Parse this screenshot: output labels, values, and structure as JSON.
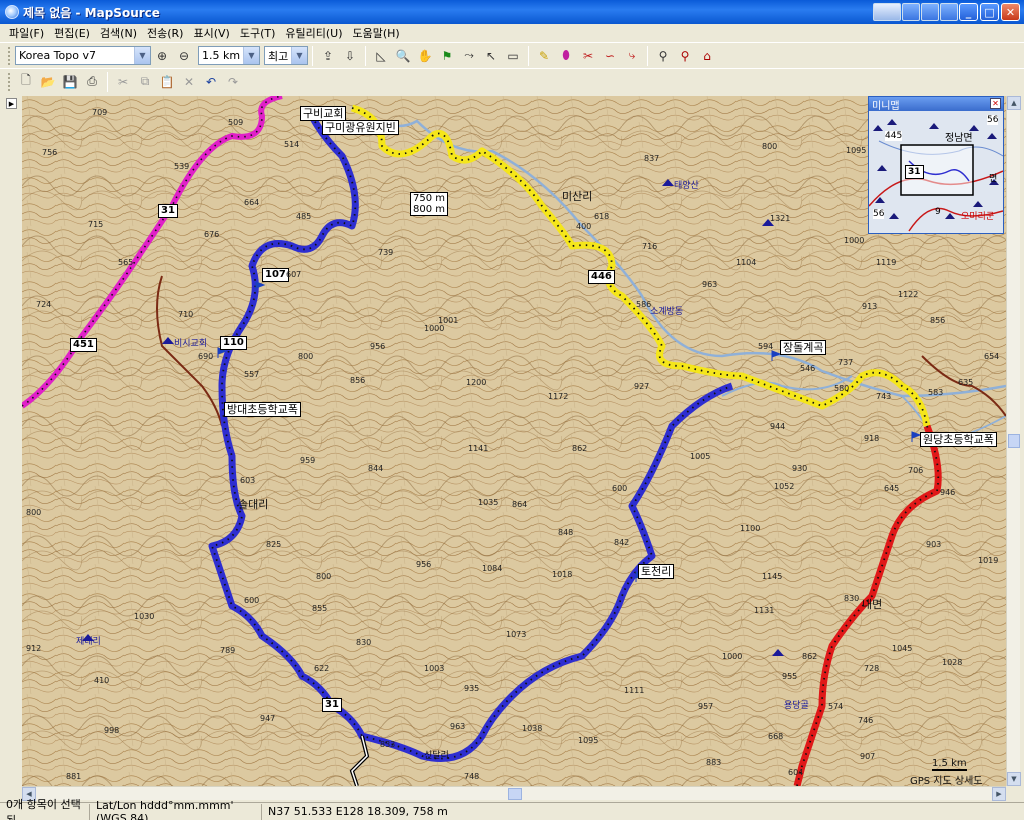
{
  "window": {
    "title": "제목 없음 - MapSource"
  },
  "menu": [
    "파일(F)",
    "편집(E)",
    "검색(N)",
    "전송(R)",
    "표시(V)",
    "도구(T)",
    "유틸리티(U)",
    "도움말(H)"
  ],
  "toolbar": {
    "map_product": "Korea Topo v7",
    "zoom_scale": "1.5 km",
    "detail_level": "최고"
  },
  "map": {
    "place_labels": {
      "l1": "구비교회",
      "l2": "구미광유원지빈",
      "l3": "미산리",
      "l4": "장돌계곡",
      "l5": "방대초등학교폭",
      "l6": "원당초등학교폭",
      "l7": "토천리",
      "l8": "솔대리",
      "l9": "내면",
      "l10": "소계방동",
      "l11": "태양산",
      "l12": "제대리",
      "l13": "비시교회",
      "l14": "용당골",
      "l15": "신달리"
    },
    "contour_labels": {
      "c1": "750 m",
      "c2": "800 m"
    },
    "road_shields": {
      "s1": "31",
      "s2": "451",
      "s3": "110",
      "s4": "107",
      "s5": "446",
      "s6": "31"
    },
    "elevations": {
      "e1": "709",
      "e2": "509",
      "e3": "514",
      "e4": "756",
      "e5": "539",
      "e6": "715",
      "e7": "676",
      "e8": "664",
      "e9": "565",
      "e10": "485",
      "e11": "607",
      "e12": "739",
      "e13": "724",
      "e14": "710",
      "e15": "690",
      "e16": "557",
      "e17": "956",
      "e18": "1001",
      "e19": "856",
      "e20": "1172",
      "e21": "862",
      "e22": "1141",
      "e23": "844",
      "e24": "959",
      "e25": "1035",
      "e26": "864",
      "e27": "848",
      "e28": "603",
      "e29": "825",
      "e30": "956",
      "e31": "1084",
      "e32": "1018",
      "e33": "842",
      "e34": "855",
      "e35": "1030",
      "e36": "1073",
      "e37": "789",
      "e38": "830",
      "e39": "622",
      "e40": "1003",
      "e41": "912",
      "e42": "410",
      "e43": "998",
      "e44": "947",
      "e45": "935",
      "e46": "963",
      "e47": "1038",
      "e48": "1095",
      "e49": "748",
      "e50": "833",
      "e51": "837",
      "e52": "618",
      "e53": "716",
      "e54": "1321",
      "e55": "1104",
      "e56": "963",
      "e57": "586",
      "e58": "594",
      "e59": "546",
      "e60": "580",
      "e61": "737",
      "e62": "743",
      "e63": "583",
      "e64": "635",
      "e65": "654",
      "e66": "918",
      "e67": "944",
      "e68": "930",
      "e69": "1052",
      "e70": "1100",
      "e71": "1145",
      "e72": "1131",
      "e73": "830",
      "e74": "862",
      "e75": "728",
      "e76": "1045",
      "e77": "1028",
      "e78": "955",
      "e79": "574",
      "e80": "746",
      "e81": "668",
      "e82": "907",
      "e83": "883",
      "e84": "604",
      "e85": "1095",
      "e86": "1119",
      "e87": "913",
      "e88": "856",
      "e89": "946",
      "e90": "903",
      "e91": "706",
      "e92": "645",
      "e93": "1005",
      "e94": "927",
      "e95": "1122",
      "e96": "1019",
      "e97": "957",
      "e98": "1111",
      "e99": "881",
      "e100": "800",
      "e101": "600",
      "e102": "1000",
      "e103": "400",
      "e104": "800",
      "e105": "1000",
      "e106": "800",
      "e107": "600",
      "e108": "800",
      "e109": "1000",
      "e110": "1200"
    },
    "scale_bar": "1.5 km",
    "attribution": "GPS 지도 상세도",
    "minimap_title": "미니맵",
    "minimap_shield": "31",
    "minimap_labels": {
      "m1": "정남면",
      "m2": "445",
      "m3": "면",
      "m4": "56",
      "m5": "56",
      "m6": "9",
      "m7": "오미리군"
    }
  },
  "status": {
    "selection": "0개 항목이 선택됨",
    "format": "Lat/Lon hddd°mm.mmm' (WGS 84)",
    "position": "N37 51.533 E128 18.309, 758 m"
  }
}
